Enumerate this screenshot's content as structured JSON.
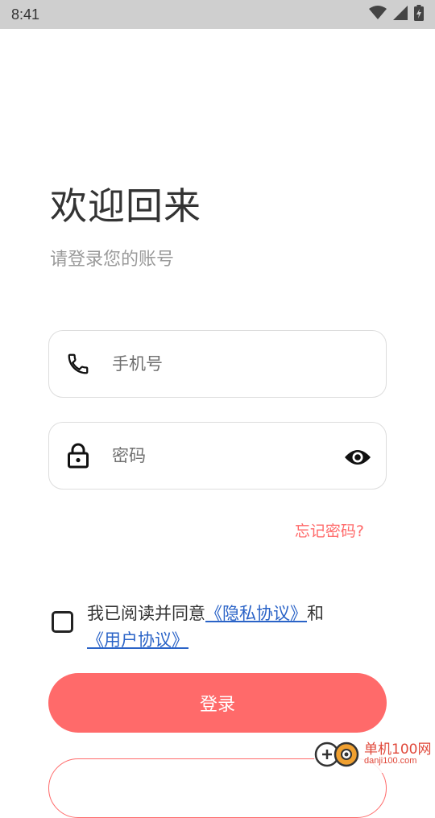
{
  "status_bar": {
    "time": "8:41",
    "icons": [
      "wifi-icon",
      "signal-icon",
      "battery-icon"
    ]
  },
  "header": {
    "title": "欢迎回来",
    "subtitle": "请登录您的账号"
  },
  "form": {
    "phone": {
      "placeholder": "手机号",
      "value": "",
      "icon": "phone-icon"
    },
    "password": {
      "placeholder": "密码",
      "value": "",
      "icon": "lock-icon",
      "toggle_icon": "eye-icon"
    },
    "forgot_label": "忘记密码?"
  },
  "agreement": {
    "checked": false,
    "prefix": "我已阅读并同意",
    "privacy_link": "《隐私协议》",
    "connector": "和",
    "user_link": "《用户协议》"
  },
  "actions": {
    "login_label": "登录"
  },
  "watermark": {
    "brand": "单机100网",
    "url": "danji100.com"
  },
  "colors": {
    "accent": "#ff6a6a",
    "link": "#2a63c7",
    "status_bar": "#cfcfcf"
  }
}
